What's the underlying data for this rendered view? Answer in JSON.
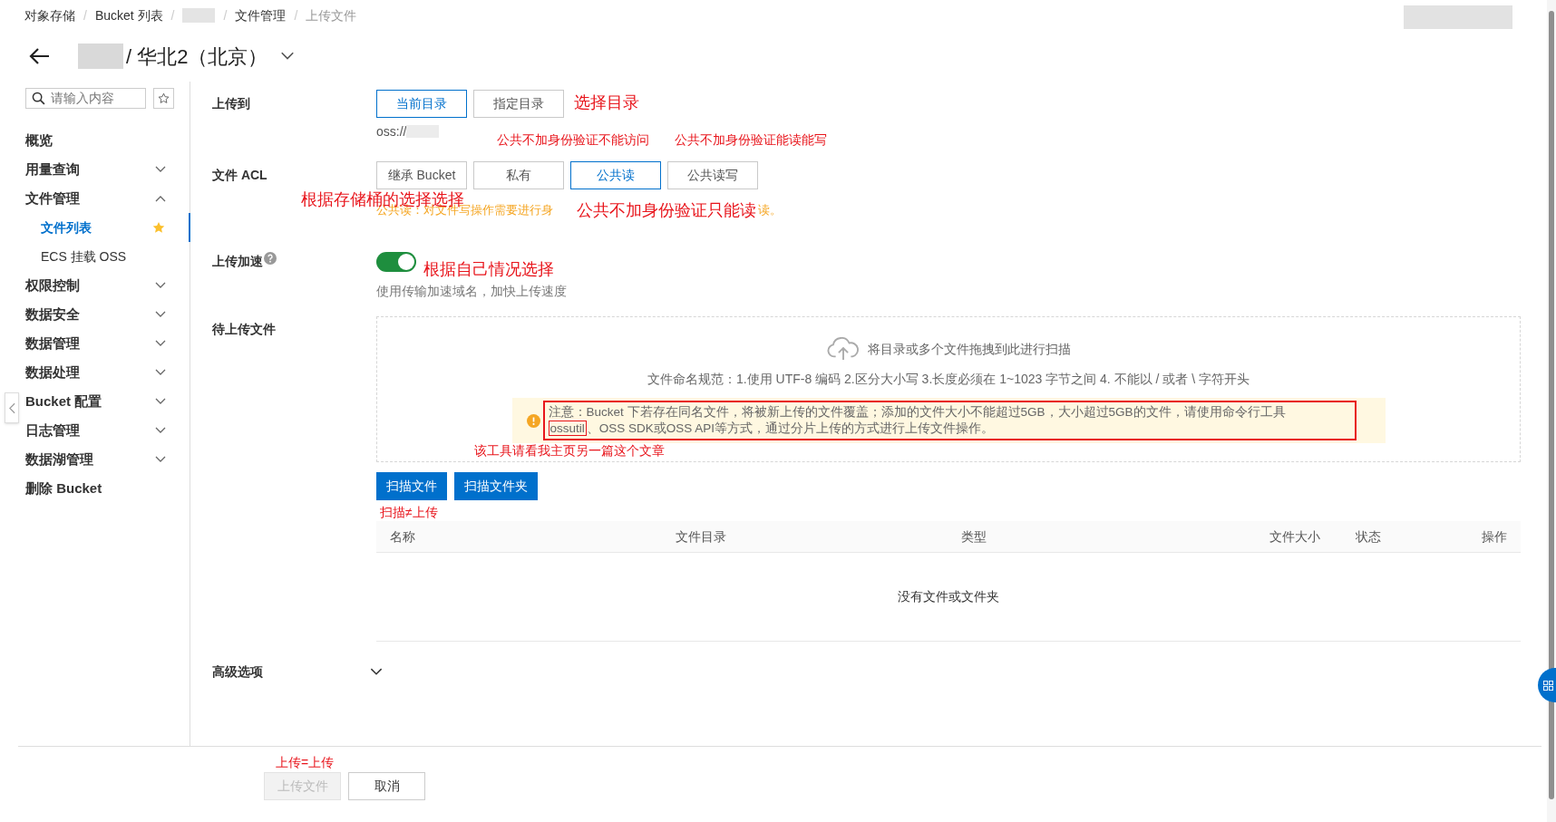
{
  "breadcrumb": {
    "separator": "/",
    "items": [
      {
        "kind": "link",
        "label": "对象存储"
      },
      {
        "kind": "link",
        "label": "Bucket 列表"
      },
      {
        "kind": "redacted"
      },
      {
        "kind": "link",
        "label": "文件管理"
      },
      {
        "kind": "current",
        "label": "上传文件"
      }
    ]
  },
  "title": {
    "region": "/ 华北2（北京）"
  },
  "sidebar": {
    "search_placeholder": "请输入内容",
    "items": [
      {
        "kind": "plain",
        "label": "概览"
      },
      {
        "kind": "group",
        "label": "用量查询",
        "expanded": false
      },
      {
        "kind": "group",
        "label": "文件管理",
        "expanded": true,
        "children": [
          {
            "label": "文件列表",
            "selected": true,
            "starred": true
          },
          {
            "label": "ECS 挂载 OSS",
            "selected": false,
            "starred": false
          }
        ]
      },
      {
        "kind": "group",
        "label": "权限控制",
        "expanded": false
      },
      {
        "kind": "group",
        "label": "数据安全",
        "expanded": false
      },
      {
        "kind": "group",
        "label": "数据管理",
        "expanded": false
      },
      {
        "kind": "group",
        "label": "数据处理",
        "expanded": false
      },
      {
        "kind": "group",
        "label": "Bucket 配置",
        "expanded": false
      },
      {
        "kind": "group",
        "label": "日志管理",
        "expanded": false
      },
      {
        "kind": "group",
        "label": "数据湖管理",
        "expanded": false
      },
      {
        "kind": "plain",
        "label": "删除 Bucket"
      }
    ]
  },
  "form": {
    "upload_to": {
      "label": "上传到",
      "options": [
        {
          "label": "当前目录",
          "selected": true
        },
        {
          "label": "指定目录",
          "selected": false
        }
      ],
      "path": "oss://"
    },
    "acl": {
      "label": "文件 ACL",
      "options": [
        {
          "label": "继承 Bucket",
          "selected": false
        },
        {
          "label": "私有",
          "selected": false
        },
        {
          "label": "公共读",
          "selected": true
        },
        {
          "label": "公共读写",
          "selected": false
        }
      ],
      "hint_start": "公共读：对文件写操作需要进行身",
      "hint_end": "读。"
    },
    "acceleration": {
      "label": "上传加速",
      "on": true,
      "hint": "使用传输加速域名，加快上传速度"
    },
    "pending": {
      "label": "待上传文件",
      "drop_text": "将目录或多个文件拖拽到此进行扫描",
      "naming_rule": "文件命名规范：1.使用 UTF-8 编码 2.区分大小写 3.长度必须在 1~1023 字节之间 4. 不能以 / 或者 \\ 字符开头",
      "note": {
        "before": "注意：Bucket 下若存在同名文件，将被新上传的文件覆盖；添加的文件大小不能超过5GB，大小超过5GB的文件，请使用命令行工具",
        "boxed": "ossutil",
        "after": "、OSS SDK或OSS API等方式，通过分片上传的方式进行上传文件操作。"
      },
      "buttons": [
        "扫描文件",
        "扫描文件夹"
      ],
      "table": {
        "columns": [
          "名称",
          "文件目录",
          "类型",
          "文件大小",
          "状态",
          "操作"
        ],
        "empty_text": "没有文件或文件夹"
      }
    },
    "advanced": {
      "label": "高级选项",
      "expanded": false
    }
  },
  "footer": {
    "buttons": [
      {
        "label": "上传文件",
        "disabled": true
      },
      {
        "label": "取消",
        "disabled": false
      }
    ]
  },
  "annotations": [
    {
      "kind": "large",
      "text": "选择目录"
    },
    {
      "kind": "small",
      "text": "公共不加身份验证不能访问"
    },
    {
      "kind": "small",
      "text": "公共不加身份验证能读能写"
    },
    {
      "kind": "large",
      "text": "根据存储桶的选择选择"
    },
    {
      "kind": "large",
      "text": "公共不加身份验证只能读"
    },
    {
      "kind": "large",
      "text": "根据自己情况选择"
    },
    {
      "kind": "small",
      "text": "该工具请看我主页另一篇这个文章"
    },
    {
      "kind": "small",
      "text": "扫描≠上传"
    },
    {
      "kind": "small",
      "text": "上传=上传"
    }
  ]
}
